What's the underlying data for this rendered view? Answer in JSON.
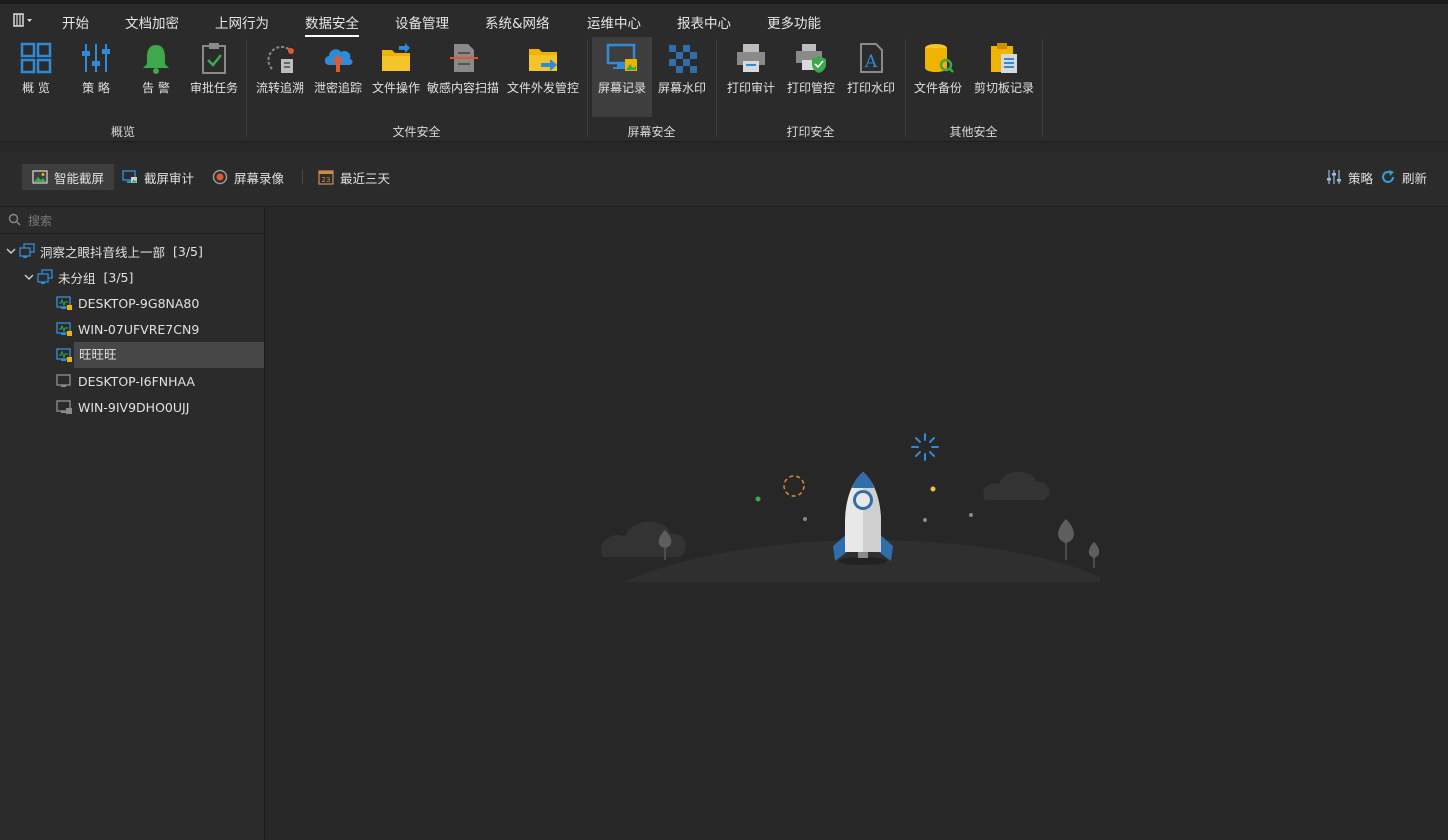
{
  "menubar": {
    "items": [
      {
        "label": "开始"
      },
      {
        "label": "文档加密"
      },
      {
        "label": "上网行为"
      },
      {
        "label": "数据安全",
        "active": true
      },
      {
        "label": "设备管理"
      },
      {
        "label": "系统&网络"
      },
      {
        "label": "运维中心"
      },
      {
        "label": "报表中心"
      },
      {
        "label": "更多功能"
      }
    ]
  },
  "ribbon": {
    "groups": [
      {
        "label": "概览",
        "buttons": [
          {
            "label": "概 览",
            "icon": "overview-grid-icon"
          },
          {
            "label": "策 略",
            "icon": "policy-sliders-icon"
          },
          {
            "label": "告 警",
            "icon": "alarm-bell-icon"
          },
          {
            "label": "审批任务",
            "icon": "approval-clipboard-icon"
          }
        ]
      },
      {
        "label": "文件安全",
        "buttons": [
          {
            "label": "流转追溯",
            "icon": "trace-icon"
          },
          {
            "label": "泄密追踪",
            "icon": "cloud-upload-icon"
          },
          {
            "label": "文件操作",
            "icon": "folder-icon"
          },
          {
            "label": "敏感内容扫描",
            "icon": "scan-document-icon"
          },
          {
            "label": "文件外发管控",
            "icon": "folder-send-icon"
          }
        ]
      },
      {
        "label": "屏幕安全",
        "buttons": [
          {
            "label": "屏幕记录",
            "icon": "screen-record-icon",
            "selected": true
          },
          {
            "label": "屏幕水印",
            "icon": "watermark-mosaic-icon"
          }
        ]
      },
      {
        "label": "打印安全",
        "buttons": [
          {
            "label": "打印审计",
            "icon": "printer-icon"
          },
          {
            "label": "打印管控",
            "icon": "printer-shield-icon"
          },
          {
            "label": "打印水印",
            "icon": "print-watermark-icon"
          }
        ]
      },
      {
        "label": "其他安全",
        "buttons": [
          {
            "label": "文件备份",
            "icon": "database-backup-icon"
          },
          {
            "label": "剪切板记录",
            "icon": "clipboard-record-icon"
          }
        ]
      }
    ]
  },
  "toolbar": {
    "smart_capture": "智能截屏",
    "capture_audit": "截屏审计",
    "screen_video": "屏幕录像",
    "date_range": "最近三天",
    "policy": "策略",
    "refresh": "刷新"
  },
  "sidebar": {
    "search_placeholder": "搜索",
    "root": {
      "label": "洞察之眼抖音线上一部",
      "count": "[3/5]"
    },
    "group": {
      "label": "未分组",
      "count": "[3/5]"
    },
    "devices": [
      {
        "label": "DESKTOP-9G8NA80",
        "status": "online"
      },
      {
        "label": "WIN-07UFVRE7CN9",
        "status": "online"
      },
      {
        "label": "旺旺旺",
        "status": "online",
        "selected": true
      },
      {
        "label": "DESKTOP-I6FNHAA",
        "status": "offline"
      },
      {
        "label": "WIN-9IV9DHO0UJJ",
        "status": "offline"
      }
    ]
  },
  "colors": {
    "accent_blue": "#2f8bd8",
    "warning_yellow": "#f0b400",
    "alarm_green": "#3da94a",
    "background": "#272727",
    "panel": "#2b2b2b"
  }
}
